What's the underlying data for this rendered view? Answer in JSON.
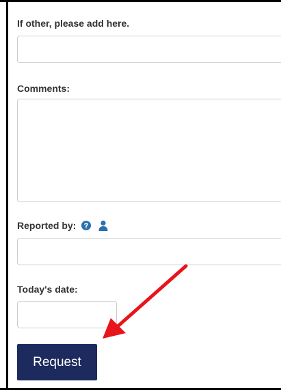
{
  "form": {
    "other_label": "If other, please add here.",
    "other_value": "",
    "comments_label": "Comments:",
    "comments_value": "",
    "reported_by_label": "Reported by:",
    "reported_by_value": "",
    "date_label": "Today's date:",
    "date_value": "",
    "request_button_label": "Request"
  },
  "icons": {
    "help": "question-circle-icon",
    "person": "user-icon",
    "annotation": "red-arrow-icon"
  },
  "colors": {
    "button_bg": "#1d2a5e",
    "icon_blue": "#2a6fb0",
    "arrow_red": "#e8141b",
    "label_text": "#333333"
  }
}
